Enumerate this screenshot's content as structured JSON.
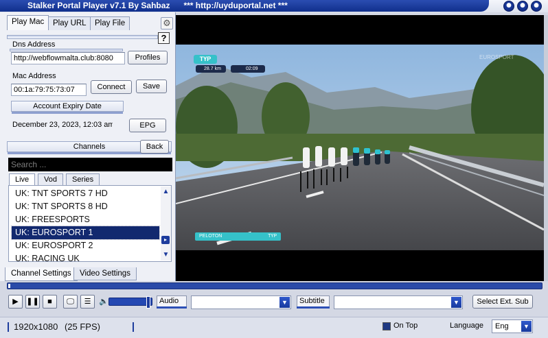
{
  "window": {
    "title": "Stalker Portal Player v7.1 By Sahbaz",
    "title_extra": "*** http://uyduportal.net ***"
  },
  "top_tabs": [
    "Play Mac",
    "Play URL",
    "Play File"
  ],
  "help_label": "?",
  "dns": {
    "label": "Dns Address",
    "value": "http://webflowmalta.club:8080",
    "profiles_button": "Profiles"
  },
  "mac": {
    "label": "Mac Address",
    "value": "00:1a:79:75:73:07",
    "connect_button": "Connect",
    "save_button": "Save"
  },
  "expiry": {
    "header": "Account Expiry Date",
    "value": "December 23, 2023, 12:03 am",
    "epg_button": "EPG"
  },
  "channels": {
    "header": "Channels",
    "back_button": "Back",
    "search_placeholder": "Search ...",
    "tabs": [
      "Live",
      "Vod",
      "Series"
    ],
    "items": [
      "UK: TNT SPORTS 7 HD",
      "UK: TNT SPORTS 8 HD",
      "UK: FREESPORTS",
      "UK: EUROSPORT 1",
      "UK: EUROSPORT 2",
      "UK: RACING UK"
    ],
    "selected_index": 3
  },
  "bottom_tabs": [
    "Channel Settings",
    "Video Settings"
  ],
  "video_overlay": {
    "flag_top": "ТҮР",
    "distance": "28.7 km",
    "time": "02:09",
    "watermark": "EUROSPORT",
    "bottom_label": "PELOTON",
    "bottom_flag": "ТҮР"
  },
  "controls": {
    "audio_label": "Audio",
    "audio_value": "",
    "subtitle_label": "Subtitle",
    "subtitle_value": "",
    "select_ext_sub": "Select Ext. Sub"
  },
  "status": {
    "resolution": "1920x1080",
    "fps": "(25 FPS)",
    "on_top_label": "On Top",
    "on_top_checked": true,
    "language_label": "Language",
    "language_value": "Eng"
  },
  "colors": {
    "accent": "#1d3c9d",
    "title_bar": "#1a3a9e",
    "selected_row": "#12296f",
    "overlay_teal": "#35c1c9"
  }
}
